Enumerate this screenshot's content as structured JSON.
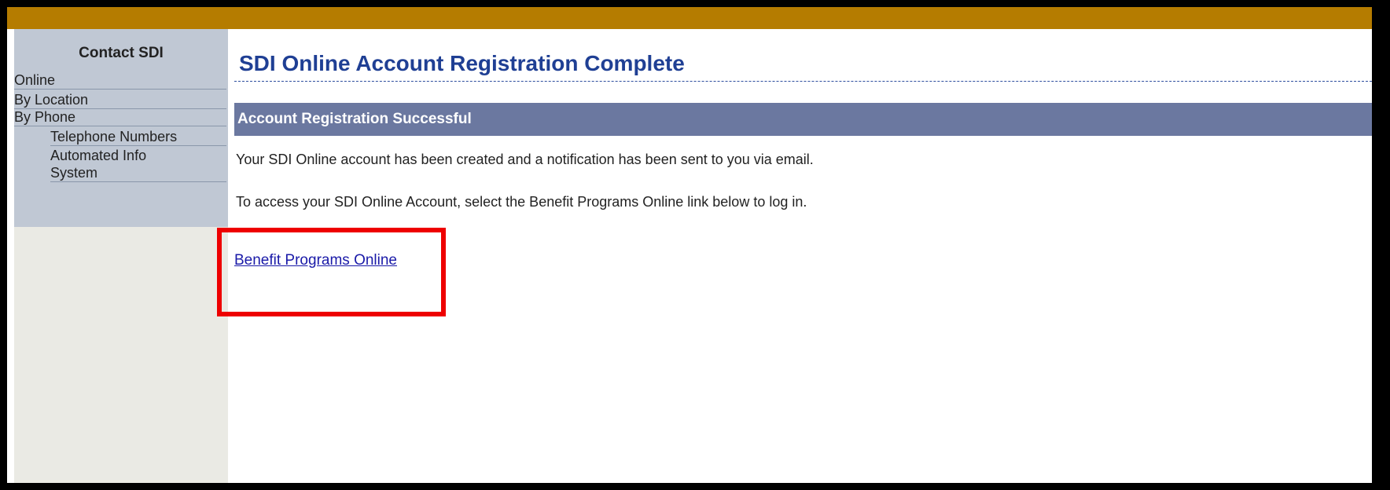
{
  "sidebar": {
    "title": "Contact SDI",
    "items": [
      {
        "label": "Online"
      },
      {
        "label": "By Location"
      },
      {
        "label": "By Phone"
      },
      {
        "label": "Telephone Numbers"
      },
      {
        "label": "Automated Info\nSystem"
      }
    ]
  },
  "main": {
    "title": "SDI Online Account Registration Complete",
    "section_header": "Account Registration Successful",
    "paragraph1": "Your SDI Online account has been created and a notification has been sent to you via email.",
    "paragraph2": "To access your SDI Online Account, select the Benefit Programs Online link below to log in.",
    "link_label": "Benefit Programs Online"
  },
  "colors": {
    "top_bar": "#b57c00",
    "highlight": "#ee0000",
    "header_bar": "#6b78a0",
    "title": "#1f3f94"
  }
}
